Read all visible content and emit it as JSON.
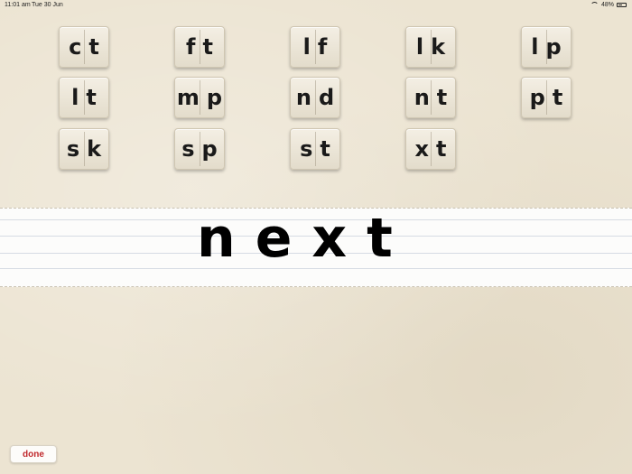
{
  "status_bar": {
    "time": "11:01 am",
    "date": "Tue 30 Jun",
    "battery": "48%"
  },
  "tiles": [
    {
      "label": "ct"
    },
    {
      "label": "ft"
    },
    {
      "label": "lf"
    },
    {
      "label": "lk"
    },
    {
      "label": "lp"
    },
    {
      "label": "lt"
    },
    {
      "label": "mp"
    },
    {
      "label": "nd"
    },
    {
      "label": "nt"
    },
    {
      "label": "pt"
    },
    {
      "label": "sk"
    },
    {
      "label": "sp"
    },
    {
      "label": "st"
    },
    {
      "label": "xt"
    }
  ],
  "word": {
    "text": "next"
  },
  "done_button": {
    "label": "done"
  },
  "colors": {
    "background": "#ece4d2",
    "done_text": "#c0282c"
  },
  "icons": [
    "wifi-icon",
    "battery-icon"
  ]
}
